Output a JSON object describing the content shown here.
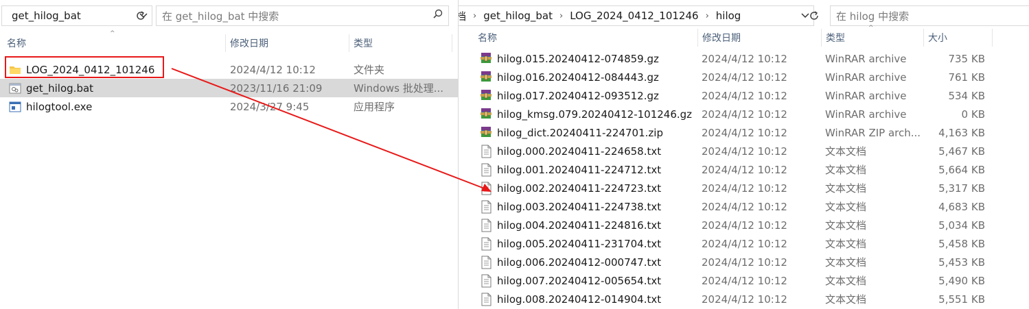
{
  "left": {
    "address": {
      "path": "get_hilog_bat",
      "dropdown_glyph": "⌄"
    },
    "search": {
      "placeholder": "在 get_hilog_bat 中搜索"
    },
    "columns": {
      "name": "名称",
      "date": "修改日期",
      "type": "类型"
    },
    "rows": [
      {
        "name": "LOG_2024_0412_101246",
        "date": "2024/4/12 10:12",
        "type": "文件夹",
        "icon": "folder-icon"
      },
      {
        "name": "get_hilog.bat",
        "date": "2023/11/16 21:09",
        "type": "Windows 批处理...",
        "icon": "batch-file-icon"
      },
      {
        "name": "hilogtool.exe",
        "date": "2024/3/27 9:45",
        "type": "应用程序",
        "icon": "exe-file-icon"
      }
    ]
  },
  "right": {
    "address": {
      "prefix": "档",
      "crumbs": [
        "get_hilog_bat",
        "LOG_2024_0412_101246",
        "hilog"
      ],
      "separator": "›"
    },
    "search": {
      "placeholder": "在 hilog 中搜索"
    },
    "columns": {
      "name": "名称",
      "date": "修改日期",
      "type": "类型",
      "size": "大小"
    },
    "rows": [
      {
        "name": "hilog.015.20240412-074859.gz",
        "date": "2024/4/12 10:12",
        "type": "WinRAR archive",
        "size": "735 KB",
        "icon": "winrar-icon"
      },
      {
        "name": "hilog.016.20240412-084443.gz",
        "date": "2024/4/12 10:12",
        "type": "WinRAR archive",
        "size": "761 KB",
        "icon": "winrar-icon"
      },
      {
        "name": "hilog.017.20240412-093512.gz",
        "date": "2024/4/12 10:12",
        "type": "WinRAR archive",
        "size": "534 KB",
        "icon": "winrar-icon"
      },
      {
        "name": "hilog_kmsg.079.20240412-101246.gz",
        "date": "2024/4/12 10:12",
        "type": "WinRAR archive",
        "size": "0 KB",
        "icon": "winrar-icon"
      },
      {
        "name": "hilog_dict.20240411-224701.zip",
        "date": "2024/4/12 10:12",
        "type": "WinRAR ZIP arch...",
        "size": "4,163 KB",
        "icon": "winrar-icon"
      },
      {
        "name": "hilog.000.20240411-224658.txt",
        "date": "2024/4/12 10:12",
        "type": "文本文档",
        "size": "5,467 KB",
        "icon": "text-file-icon"
      },
      {
        "name": "hilog.001.20240411-224712.txt",
        "date": "2024/4/12 10:12",
        "type": "文本文档",
        "size": "5,664 KB",
        "icon": "text-file-icon"
      },
      {
        "name": "hilog.002.20240411-224723.txt",
        "date": "2024/4/12 10:12",
        "type": "文本文档",
        "size": "5,317 KB",
        "icon": "text-file-icon"
      },
      {
        "name": "hilog.003.20240411-224738.txt",
        "date": "2024/4/12 10:12",
        "type": "文本文档",
        "size": "4,683 KB",
        "icon": "text-file-icon"
      },
      {
        "name": "hilog.004.20240411-224816.txt",
        "date": "2024/4/12 10:12",
        "type": "文本文档",
        "size": "5,034 KB",
        "icon": "text-file-icon"
      },
      {
        "name": "hilog.005.20240411-231704.txt",
        "date": "2024/4/12 10:12",
        "type": "文本文档",
        "size": "5,458 KB",
        "icon": "text-file-icon"
      },
      {
        "name": "hilog.006.20240412-000747.txt",
        "date": "2024/4/12 10:12",
        "type": "文本文档",
        "size": "5,453 KB",
        "icon": "text-file-icon"
      },
      {
        "name": "hilog.007.20240412-005654.txt",
        "date": "2024/4/12 10:12",
        "type": "文本文档",
        "size": "5,490 KB",
        "icon": "text-file-icon"
      },
      {
        "name": "hilog.008.20240412-014904.txt",
        "date": "2024/4/12 10:12",
        "type": "文本文档",
        "size": "5,551 KB",
        "icon": "text-file-icon"
      }
    ]
  },
  "annotation": {
    "color": "#e81818"
  }
}
